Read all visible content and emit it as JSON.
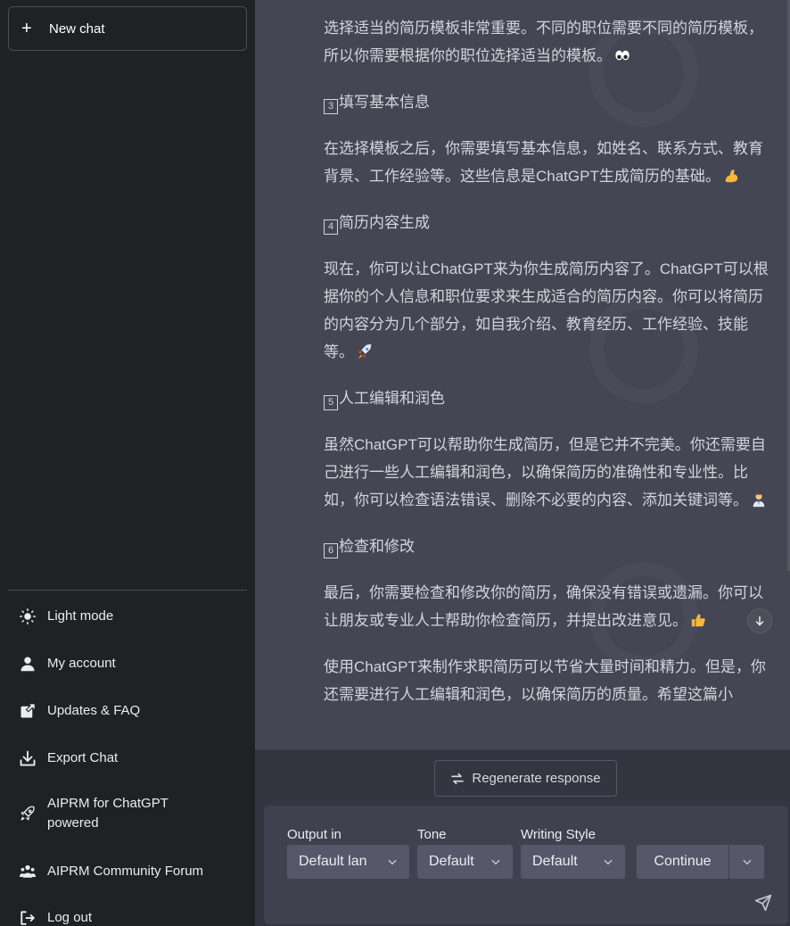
{
  "sidebar": {
    "new_chat": "New chat",
    "items": [
      {
        "label": "Light mode",
        "icon": "sun-icon"
      },
      {
        "label": "My account",
        "icon": "user-icon"
      },
      {
        "label": "Updates & FAQ",
        "icon": "external-link-icon"
      },
      {
        "label": "Export Chat",
        "icon": "download-icon"
      },
      {
        "label": "AIPRM for ChatGPT powered",
        "icon": "rocket-icon"
      },
      {
        "label": "AIPRM Community Forum",
        "icon": "users-icon"
      },
      {
        "label": "Log out",
        "icon": "logout-icon"
      }
    ]
  },
  "message": {
    "p1": "选择适当的简历模板非常重要。不同的职位需要不同的简历模板，所以你需要根据你的职位选择适当的模板。",
    "h3_num": "3",
    "h3": "填写基本信息",
    "p3": "在选择模板之后，你需要填写基本信息，如姓名、联系方式、教育背景、工作经验等。这些信息是ChatGPT生成简历的基础。",
    "h4_num": "4",
    "h4": "简历内容生成",
    "p4": "现在，你可以让ChatGPT来为你生成简历内容了。ChatGPT可以根据你的个人信息和职位要求来生成适合的简历内容。你可以将简历的内容分为几个部分，如自我介绍、教育经历、工作经验、技能等。",
    "h5_num": "5",
    "h5": "人工编辑和润色",
    "p5": "虽然ChatGPT可以帮助你生成简历，但是它并不完美。你还需要自己进行一些人工编辑和润色，以确保简历的准确性和专业性。比如，你可以检查语法错误、删除不必要的内容、添加关键词等。",
    "h6_num": "6",
    "h6": "检查和修改",
    "p6": "最后，你需要检查和修改你的简历，确保没有错误或遗漏。你可以让朋友或专业人士帮助你检查简历，并提出改进意见。",
    "p7": "使用ChatGPT来制作求职简历可以节省大量时间和精力。但是，你还需要进行人工编辑和润色，以确保简历的质量。希望这篇小"
  },
  "controls": {
    "regenerate": "Regenerate response",
    "output_label": "Output in",
    "output_value": "Default lan",
    "tone_label": "Tone",
    "tone_value": "Default",
    "style_label": "Writing Style",
    "style_value": "Default",
    "continue": "Continue"
  },
  "colors": {
    "sidebar_bg": "#202123",
    "main_bg": "#444654",
    "composer_bg": "#40414f",
    "select_bg": "#565869"
  }
}
